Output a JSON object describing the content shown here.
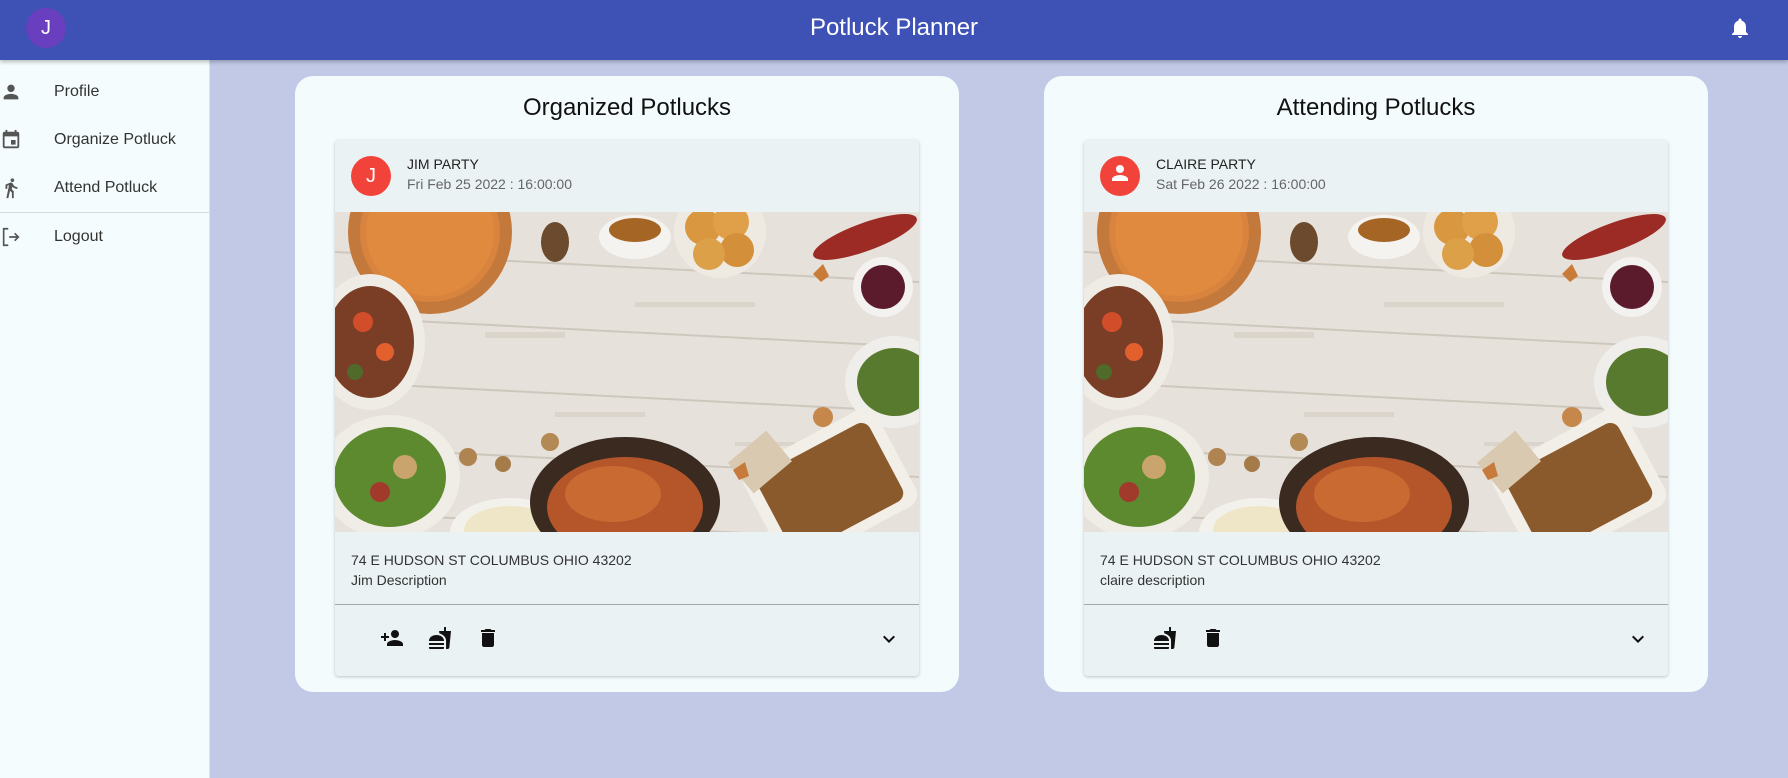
{
  "app": {
    "title": "Potluck Planner",
    "user_initial": "J"
  },
  "sidebar": {
    "items": [
      {
        "label": "Profile",
        "icon": "person-icon"
      },
      {
        "label": "Organize Potluck",
        "icon": "calendar-icon"
      },
      {
        "label": "Attend Potluck",
        "icon": "walk-icon"
      },
      {
        "label": "Logout",
        "icon": "logout-icon"
      }
    ]
  },
  "panels": {
    "organized": {
      "title": "Organized Potlucks",
      "card": {
        "avatar_initial": "J",
        "title": "JIM PARTY",
        "date": "Fri Feb 25 2022 : 16:00:00",
        "address": "74 E HUDSON ST COLUMBUS OHIO 43202",
        "description": "Jim Description",
        "actions": [
          "add-guest-icon",
          "food-icon",
          "delete-icon"
        ]
      }
    },
    "attending": {
      "title": "Attending Potlucks",
      "card": {
        "avatar_icon": "person-icon",
        "title": "CLAIRE PARTY",
        "date": "Sat Feb 26 2022 : 16:00:00",
        "address": "74 E HUDSON ST COLUMBUS OHIO 43202",
        "description": "claire description",
        "actions": [
          "food-icon",
          "delete-icon"
        ]
      }
    }
  },
  "colors": {
    "appbar": "#3e51b5",
    "background": "#c1c9e7",
    "panel": "#f3fbfd",
    "card": "#eaf2f4",
    "avatar_user": "#6a3fbf",
    "avatar_card": "#f2433a"
  }
}
